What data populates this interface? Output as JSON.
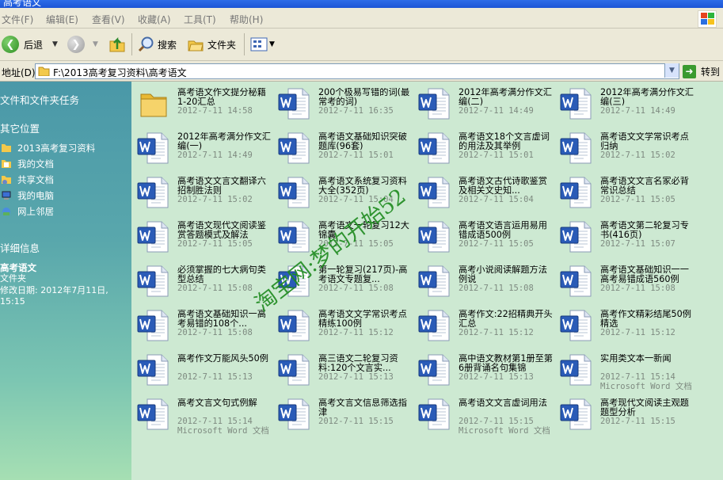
{
  "window": {
    "title": "高考语文"
  },
  "menu": [
    "文件(F)",
    "编辑(E)",
    "查看(V)",
    "收藏(A)",
    "工具(T)",
    "帮助(H)"
  ],
  "toolbar": {
    "back": "后退",
    "search": "搜索",
    "folders": "文件夹"
  },
  "address": {
    "label": "地址(D)",
    "path": "F:\\2013高考复习资料\\高考语文",
    "go": "转到"
  },
  "left_pane": {
    "tasks_title": "文件和文件夹任务",
    "places_title": "其它位置",
    "places": [
      "2013高考复习资料",
      "我的文档",
      "共享文档",
      "我的电脑",
      "网上邻居"
    ],
    "details_title": "详细信息",
    "details_name": "高考语文",
    "details_type": "文件夹",
    "details_modified_1": "修改日期: 2012年7月11日,",
    "details_modified_2": "15:15"
  },
  "files": [
    {
      "name": "高考语文作文提分秘籍1-20汇总",
      "date": "2012-7-11 14:58",
      "type": "",
      "kind": "folder"
    },
    {
      "name": "200个极易写错的词(最常考的词)",
      "date": "2012-7-11 16:35",
      "type": "",
      "kind": "word"
    },
    {
      "name": "2012年高考满分作文汇编(二)",
      "date": "2012-7-11 14:49",
      "type": "",
      "kind": "word"
    },
    {
      "name": "2012年高考满分作文汇编(三)",
      "date": "2012-7-11 14:49",
      "type": "",
      "kind": "word"
    },
    {
      "name": "2012年高考满分作文汇编(一)",
      "date": "2012-7-11 14:49",
      "type": "",
      "kind": "word"
    },
    {
      "name": "高考语文基础知识突破题库(96套)",
      "date": "2012-7-11 15:01",
      "type": "",
      "kind": "word"
    },
    {
      "name": "高考语文18个文言虚词的用法及其举例",
      "date": "2012-7-11 15:01",
      "type": "",
      "kind": "word"
    },
    {
      "name": "高考语文文学常识考点归纳",
      "date": "2012-7-11 15:02",
      "type": "",
      "kind": "word"
    },
    {
      "name": "高考语文文言文翻译六招制胜法则",
      "date": "2012-7-11 15:02",
      "type": "",
      "kind": "word"
    },
    {
      "name": "高考语文系统复习资料大全(352页)",
      "date": "2012-7-11 15:04",
      "type": "",
      "kind": "word"
    },
    {
      "name": "高考语文古代诗歌鉴赏及相关文史知...",
      "date": "2012-7-11 15:04",
      "type": "",
      "kind": "word"
    },
    {
      "name": "高考语文文言名家必背常识总结",
      "date": "2012-7-11 15:05",
      "type": "",
      "kind": "word"
    },
    {
      "name": "高考语文现代文阅读鉴赏答题模式及解法",
      "date": "2012-7-11 15:05",
      "type": "",
      "kind": "word"
    },
    {
      "name": "高考语文一轮复习12大锦囊",
      "date": "2012-7-11 15:05",
      "type": "",
      "kind": "word"
    },
    {
      "name": "高考语文语言运用易用错成语500例",
      "date": "2012-7-11 15:05",
      "type": "",
      "kind": "word"
    },
    {
      "name": "高考语文第二轮复习专书(416页)",
      "date": "2012-7-11 15:07",
      "type": "",
      "kind": "word"
    },
    {
      "name": "必须掌握的七大病句类型总结",
      "date": "2012-7-11 15:08",
      "type": "",
      "kind": "word"
    },
    {
      "name": "第一轮复习(217页)-高考语文专题复...",
      "date": "2012-7-11 15:08",
      "type": "",
      "kind": "word"
    },
    {
      "name": "高考小说阅读解题方法例说",
      "date": "2012-7-11 15:08",
      "type": "",
      "kind": "word"
    },
    {
      "name": "高考语文基础知识一一高考易错成语560例",
      "date": "2012-7-11 15:08",
      "type": "",
      "kind": "word"
    },
    {
      "name": "高考语文基础知识一高考易错的108个...",
      "date": "2012-7-11 15:08",
      "type": "",
      "kind": "word"
    },
    {
      "name": "高考语文文学常识考点精练100例",
      "date": "2012-7-11 15:12",
      "type": "",
      "kind": "word"
    },
    {
      "name": "高考作文:22招精典开头汇总",
      "date": "2012-7-11 15:12",
      "type": "",
      "kind": "word"
    },
    {
      "name": "高考作文精彩结尾50例精选",
      "date": "2012-7-11 15:12",
      "type": "",
      "kind": "word"
    },
    {
      "name": "高考作文万能风头50例",
      "date": "2012-7-11 15:13",
      "type": "",
      "kind": "word"
    },
    {
      "name": "高三语文二轮复习资料:120个文言实...",
      "date": "2012-7-11 15:13",
      "type": "",
      "kind": "word"
    },
    {
      "name": "高中语文教材第1册至第6册背诵名句集锦",
      "date": "2012-7-11 15:13",
      "type": "",
      "kind": "word"
    },
    {
      "name": "实用类文本一新闻",
      "date": "2012-7-11 15:14",
      "type": "Microsoft Word 文档",
      "kind": "word"
    },
    {
      "name": "高考文言文句式例解",
      "date": "2012-7-11 15:14",
      "type": "Microsoft Word 文档",
      "kind": "word"
    },
    {
      "name": "高考文言文信息筛选指津",
      "date": "2012-7-11 15:15",
      "type": "",
      "kind": "word"
    },
    {
      "name": "高考语文文言虚词用法",
      "date": "2012-7-11 15:15",
      "type": "Microsoft Word 文档",
      "kind": "word"
    },
    {
      "name": "高考现代文阅读主观题题型分析",
      "date": "2012-7-11 15:15",
      "type": "",
      "kind": "word"
    }
  ],
  "watermark": "淘宝网:梦的开始52",
  "colors": {
    "window_bg": "#cde9d2",
    "title_bar": "#1c55d5",
    "word_blue": "#2a5bb7"
  }
}
